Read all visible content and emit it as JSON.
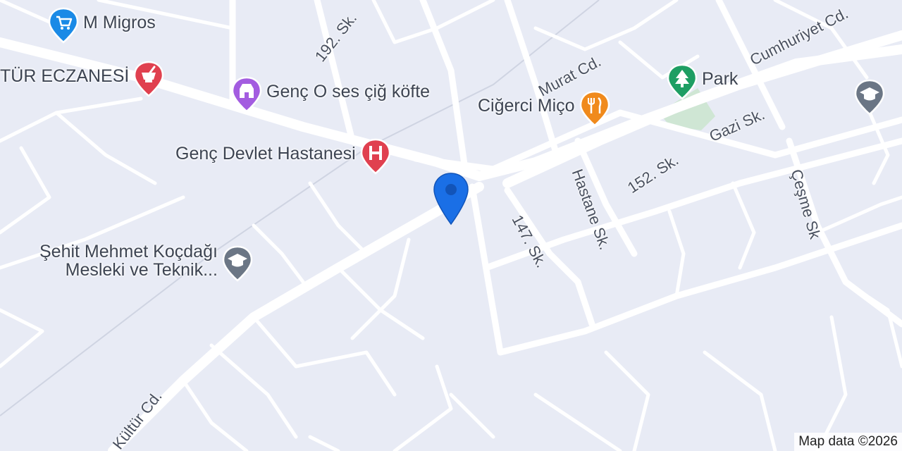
{
  "map": {
    "attribution": "Map data ©2026"
  },
  "streets": {
    "s192": "192. Sk.",
    "murat": "Murat Cd.",
    "cumhuriyet": "Cumhuriyet Cd.",
    "gazi": "Gazi Sk.",
    "s152": "152. Sk.",
    "hastane": "Hastane Sk.",
    "s147": "147. Sk.",
    "cesme": "Çeşme Sk",
    "kultur": "Kültür Cd."
  },
  "pois": {
    "migros": {
      "label": "M Migros",
      "icon": "shopping-cart-icon",
      "color": "#1a8ae6"
    },
    "eczane": {
      "label": "TÜR ECZANESİ",
      "icon": "pharmacy-mortar-icon",
      "color": "#e0404f"
    },
    "cigkofte": {
      "label": "Genç O ses çiğ köfte",
      "icon": "shop-icon",
      "color": "#a35ce0"
    },
    "cigerci": {
      "label": "Ciğerci Miço",
      "icon": "restaurant-fork-knife-icon",
      "color": "#f08a1c"
    },
    "park": {
      "label": "Park",
      "icon": "tree-icon",
      "color": "#1e9e63"
    },
    "hastane": {
      "label": "Genç Devlet Hastanesi",
      "icon": "hospital-h-icon",
      "color": "#e0404f"
    },
    "school1": {
      "label_line1": "Şehit Mehmet Koçdağı",
      "label_line2": "Mesleki ve Teknik...",
      "icon": "graduation-cap-icon",
      "color": "#6b7685"
    },
    "school2": {
      "icon": "graduation-cap-icon",
      "color": "#6b7685"
    }
  },
  "location_marker": {
    "icon": "location-pin-icon",
    "color": "#1a6fe6"
  }
}
